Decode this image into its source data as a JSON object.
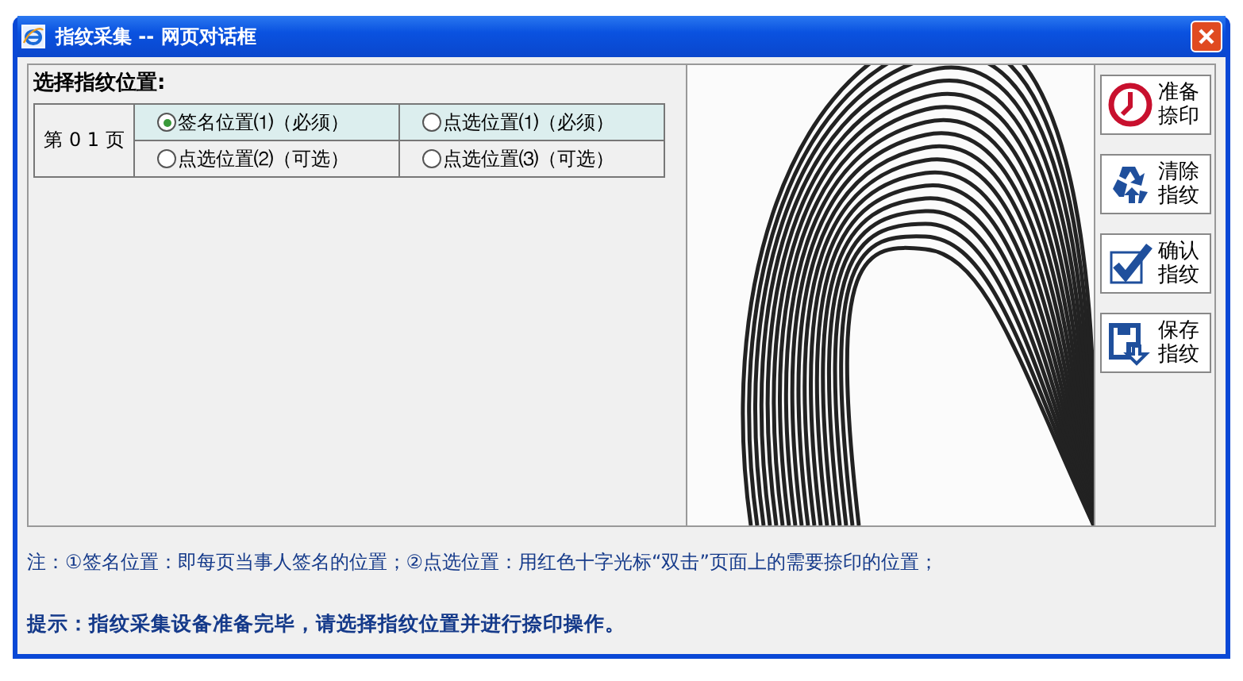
{
  "window": {
    "title": "指纹采集 -- 网页对话框"
  },
  "position_panel": {
    "heading": "选择指纹位置:",
    "page_label": "第 0 1 页",
    "rows": [
      {
        "highlighted": true,
        "options": [
          {
            "label": "签名位置⑴（必须）",
            "selected": true
          },
          {
            "label": "点选位置⑴（必须）",
            "selected": false
          }
        ]
      },
      {
        "highlighted": false,
        "options": [
          {
            "label": "点选位置⑵（可选）",
            "selected": false
          },
          {
            "label": "点选位置⑶（可选）",
            "selected": false
          }
        ]
      }
    ]
  },
  "buttons": [
    {
      "kind": "clock",
      "label": "准备捺印"
    },
    {
      "kind": "recycle",
      "label": "清除指纹"
    },
    {
      "kind": "check",
      "label": "确认指纹"
    },
    {
      "kind": "save",
      "label": "保存指纹"
    }
  ],
  "note": "注：①签名位置：即每页当事人签名的位置；②点选位置：用红色十字光标“双击”页面上的需要捺印的位置；",
  "hint": "提示：指纹采集设备准备完毕，请选择指纹位置并进行捺印操作。"
}
